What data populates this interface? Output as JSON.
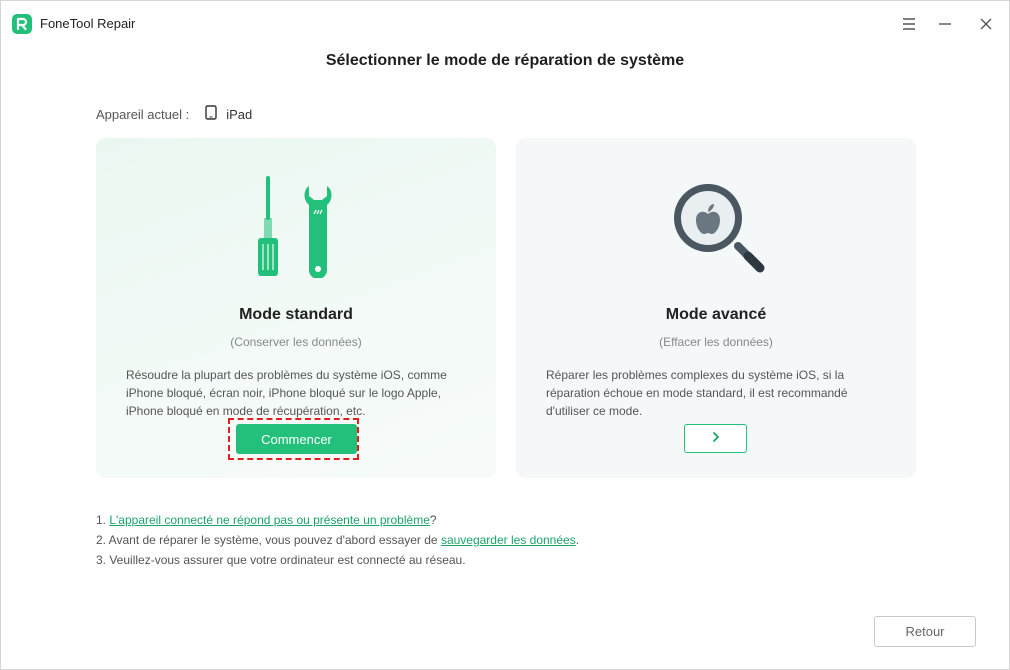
{
  "app": {
    "title": "FoneTool Repair",
    "icon": "fonetool-logo-icon"
  },
  "window_controls": [
    "menu-icon",
    "minimize-icon",
    "close-icon"
  ],
  "page": {
    "title": "Sélectionner le mode de réparation de système"
  },
  "device": {
    "label": "Appareil actuel :",
    "name": "iPad",
    "icon": "tablet-icon"
  },
  "modes": {
    "standard": {
      "icon": "screwdriver-wrench-icon",
      "title": "Mode standard",
      "subtitle": "(Conserver les données)",
      "description": "Résoudre la plupart des problèmes du système iOS, comme iPhone bloqué, écran noir, iPhone bloqué sur le logo Apple, iPhone bloqué en mode de récupération, etc.",
      "button_label": "Commencer"
    },
    "advanced": {
      "icon": "apple-magnifier-icon",
      "title": "Mode avancé",
      "subtitle": "(Effacer les données)",
      "description": "Réparer les problèmes complexes du système iOS, si la réparation échoue en mode standard, il est recommandé d'utiliser ce mode.",
      "button_icon": "chevron-right-icon"
    }
  },
  "notes": {
    "n1_prefix": "1. ",
    "n1_link": "L'appareil connecté ne répond pas ou présente un problème",
    "n1_suffix": "?",
    "n2_prefix": "2. Avant de réparer le système, vous pouvez d'abord essayer de ",
    "n2_link": "sauvegarder les données",
    "n2_suffix": ".",
    "n3": "3. Veuillez-vous assurer que votre ordinateur est connecté au réseau."
  },
  "footer": {
    "back_label": "Retour"
  },
  "colors": {
    "accent": "#22c07a",
    "highlight_border": "#e02020"
  }
}
